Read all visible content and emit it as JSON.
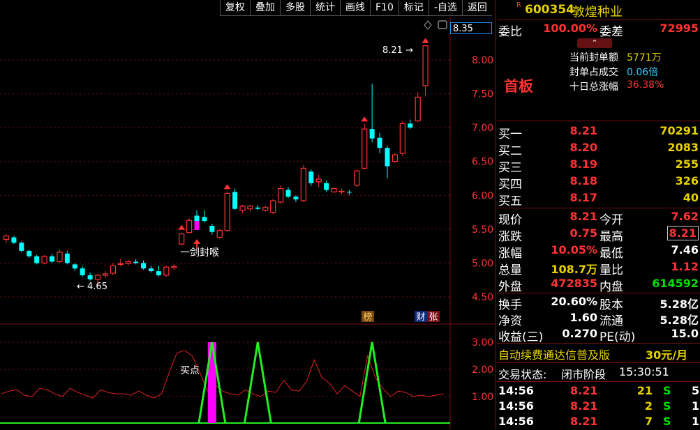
{
  "toolbar": [
    {
      "id": "restore",
      "label": "复权"
    },
    {
      "id": "overlay",
      "label": "叠加"
    },
    {
      "id": "multi",
      "label": "多股"
    },
    {
      "id": "stats",
      "label": "统计"
    },
    {
      "id": "draw",
      "label": "画线"
    },
    {
      "id": "f10",
      "label": "F10"
    },
    {
      "id": "mark",
      "label": "标记"
    },
    {
      "id": "watch",
      "label": "-自选"
    },
    {
      "id": "back",
      "label": "返回"
    }
  ],
  "stock": {
    "badge": "R",
    "code": "600354",
    "name": "敦煌种业"
  },
  "commission": {
    "ratio_label": "委比",
    "ratio": "100.00%",
    "diff_label": "委差",
    "diff": "72995"
  },
  "limit_info": {
    "tag": "首板",
    "items": [
      {
        "label": "当前封单额",
        "value": "5771万"
      },
      {
        "label": "封单占成交",
        "value": "0.06倍"
      },
      {
        "label": "十日总涨幅",
        "value": "36.38%"
      }
    ]
  },
  "bids": [
    {
      "label": "买一",
      "price": "8.21",
      "vol": "70291"
    },
    {
      "label": "买二",
      "price": "8.20",
      "vol": "2083"
    },
    {
      "label": "买三",
      "price": "8.19",
      "vol": "255"
    },
    {
      "label": "买四",
      "price": "8.18",
      "vol": "326"
    },
    {
      "label": "买五",
      "price": "8.17",
      "vol": "40"
    }
  ],
  "quote": [
    {
      "l1": "现价",
      "v1": "8.21",
      "l2": "今开",
      "v2": "7.62"
    },
    {
      "l1": "涨跌",
      "v1": "0.75",
      "l2": "最高",
      "v2": "8.21"
    },
    {
      "l1": "涨幅",
      "v1": "10.05%",
      "l2": "最低",
      "v2": "7.46"
    },
    {
      "l1": "总量",
      "v1": "108.7万",
      "l2": "量比",
      "v2": "1.12"
    },
    {
      "l1": "外盘",
      "v1": "472835",
      "l2": "内盘",
      "v2": "614592"
    }
  ],
  "fundamentals": [
    {
      "l1": "换手",
      "v1": "20.60%",
      "l2": "股本",
      "v2": "5.28亿"
    },
    {
      "l1": "净资",
      "v1": "1.60",
      "l2": "流通",
      "v2": "5.28亿"
    },
    {
      "l1": "收益(三)",
      "v1": "0.270",
      "l2": "PE(动)",
      "v2": "15.0"
    }
  ],
  "ad": {
    "text": "自动续费通达信普及版",
    "price": "30元/月"
  },
  "trade_status": {
    "label": "交易状态:",
    "value": "闭市阶段",
    "time": "15:30:51"
  },
  "ticks": [
    {
      "time": "14:56",
      "price": "8.21",
      "vol": "21",
      "side": "S",
      "count": "5"
    },
    {
      "time": "14:56",
      "price": "8.21",
      "vol": "2",
      "side": "S",
      "count": "1"
    },
    {
      "time": "14:56",
      "price": "8.21",
      "vol": "7",
      "side": "S",
      "count": "1"
    }
  ],
  "price_box": "8.35",
  "colors": {
    "up": "#ff3333",
    "down": "#00ffff",
    "grid": "#7a1010",
    "bg": "#000000",
    "line": "#e02020",
    "signal": "#22ee22",
    "buy_bar": "#ff00ff"
  },
  "chart_data": [
    {
      "type": "candlestick",
      "ylim": [
        4.2,
        8.5
      ],
      "yticks": [
        "8.00",
        "7.50",
        "7.00",
        "6.50",
        "6.00",
        "5.50",
        "5.00",
        "4.50"
      ],
      "annotations": [
        {
          "text": "8.21",
          "at_value": 8.21
        },
        {
          "text": "4.65",
          "at_value": 4.65
        },
        {
          "text": "一剑封喉",
          "at_value": 5.4
        }
      ],
      "badges": [
        "榜",
        "财",
        "张"
      ],
      "candles": [
        [
          5.35,
          5.42,
          5.3,
          5.4
        ],
        [
          5.38,
          5.4,
          5.28,
          5.3
        ],
        [
          5.3,
          5.32,
          5.16,
          5.18
        ],
        [
          5.18,
          5.2,
          5.08,
          5.1
        ],
        [
          5.1,
          5.12,
          4.98,
          5.0
        ],
        [
          5.0,
          5.12,
          4.98,
          5.1
        ],
        [
          5.1,
          5.14,
          5.0,
          5.02
        ],
        [
          5.02,
          5.2,
          5.0,
          5.16
        ],
        [
          5.14,
          5.18,
          4.98,
          5.0
        ],
        [
          4.98,
          5.0,
          4.88,
          4.92
        ],
        [
          4.92,
          4.95,
          4.8,
          4.82
        ],
        [
          4.82,
          4.86,
          4.74,
          4.76
        ],
        [
          4.76,
          4.84,
          4.65,
          4.82
        ],
        [
          4.82,
          4.88,
          4.78,
          4.84
        ],
        [
          4.85,
          5.0,
          4.82,
          4.96
        ],
        [
          4.98,
          5.06,
          4.95,
          4.99
        ],
        [
          4.99,
          5.04,
          4.96,
          5.02
        ],
        [
          5.02,
          5.06,
          4.98,
          5.0
        ],
        [
          5.0,
          5.04,
          4.9,
          4.92
        ],
        [
          4.92,
          4.96,
          4.86,
          4.88
        ],
        [
          4.88,
          4.96,
          4.8,
          4.82
        ],
        [
          4.82,
          4.96,
          4.8,
          4.94
        ],
        [
          4.93,
          4.98,
          4.9,
          4.95
        ],
        [
          5.28,
          5.45,
          5.26,
          5.43
        ],
        [
          5.45,
          5.66,
          5.44,
          5.63
        ],
        [
          5.7,
          5.78,
          5.6,
          5.62
        ],
        [
          5.68,
          5.78,
          5.6,
          5.62
        ],
        [
          5.55,
          5.58,
          5.42,
          5.46
        ],
        [
          5.38,
          5.5,
          5.36,
          5.48
        ],
        [
          5.48,
          6.05,
          5.46,
          6.03
        ],
        [
          6.05,
          6.1,
          5.78,
          5.8
        ],
        [
          5.78,
          5.86,
          5.74,
          5.84
        ],
        [
          5.8,
          5.86,
          5.76,
          5.84
        ],
        [
          5.82,
          5.86,
          5.78,
          5.8
        ],
        [
          5.78,
          5.85,
          5.76,
          5.82
        ],
        [
          5.75,
          5.95,
          5.72,
          5.92
        ],
        [
          5.9,
          6.15,
          5.88,
          6.1
        ],
        [
          6.08,
          6.12,
          5.96,
          5.98
        ],
        [
          5.98,
          6.0,
          5.9,
          5.94
        ],
        [
          5.92,
          6.45,
          5.9,
          6.4
        ],
        [
          6.35,
          6.38,
          6.14,
          6.18
        ],
        [
          6.2,
          6.3,
          6.12,
          6.24
        ],
        [
          6.18,
          6.22,
          6.05,
          6.08
        ],
        [
          6.05,
          6.12,
          6.04,
          6.1
        ],
        [
          6.06,
          6.1,
          6.02,
          6.06
        ],
        [
          6.05,
          6.08,
          6.0,
          6.04
        ],
        [
          6.15,
          6.38,
          6.12,
          6.36
        ],
        [
          6.4,
          7.05,
          6.38,
          6.98
        ],
        [
          6.98,
          7.65,
          6.78,
          6.84
        ],
        [
          6.85,
          6.92,
          6.62,
          6.7
        ],
        [
          6.7,
          6.73,
          6.25,
          6.43
        ],
        [
          6.5,
          6.62,
          6.48,
          6.6
        ],
        [
          6.62,
          7.1,
          6.58,
          7.06
        ],
        [
          7.06,
          7.12,
          6.98,
          7.0
        ],
        [
          7.1,
          7.52,
          7.08,
          7.45
        ],
        [
          7.62,
          8.21,
          7.46,
          8.21
        ]
      ]
    },
    {
      "type": "line",
      "ylim": [
        0,
        3.4
      ],
      "yticks": [
        "3.00",
        "2.00",
        "1.00"
      ],
      "annotations": [
        {
          "text": "买点",
          "at_value": 2.1
        }
      ],
      "series": [
        {
          "values": [
            1.1,
            1.2,
            1.25,
            1.05,
            1.0,
            1.3,
            1.25,
            1.1,
            1.0,
            1.3,
            1.15,
            1.05,
            0.95,
            1.25,
            1.15,
            1.1,
            1.1,
            1.05,
            1.2,
            1.05,
            0.95,
            1.1,
            1.9,
            2.6,
            2.7,
            2.5,
            1.9,
            1.2,
            1.45,
            1.2,
            1.1,
            1.05,
            1.25,
            1.1,
            1.0,
            1.2,
            1.15,
            1.6,
            1.25,
            1.2,
            1.55,
            2.35,
            1.7,
            1.5,
            1.1,
            1.4,
            1.2,
            1.0,
            2.5,
            1.7,
            1.3,
            1.0,
            1.2,
            1.15,
            1.0,
            1.05,
            1.0,
            1.05,
            1.1
          ]
        }
      ],
      "signals": [
        {
          "base": 0.1,
          "peak": 3.0,
          "start": 26,
          "peakAt": 27,
          "end": 28
        },
        {
          "base": 0.1,
          "peak": 3.0,
          "start": 32,
          "peakAt": 33,
          "end": 34
        },
        {
          "base": 0.1,
          "peak": 3.0,
          "start": 47,
          "peakAt": 48,
          "end": 49
        }
      ],
      "buy_bar": {
        "index": 27,
        "value": 3.0
      }
    }
  ]
}
